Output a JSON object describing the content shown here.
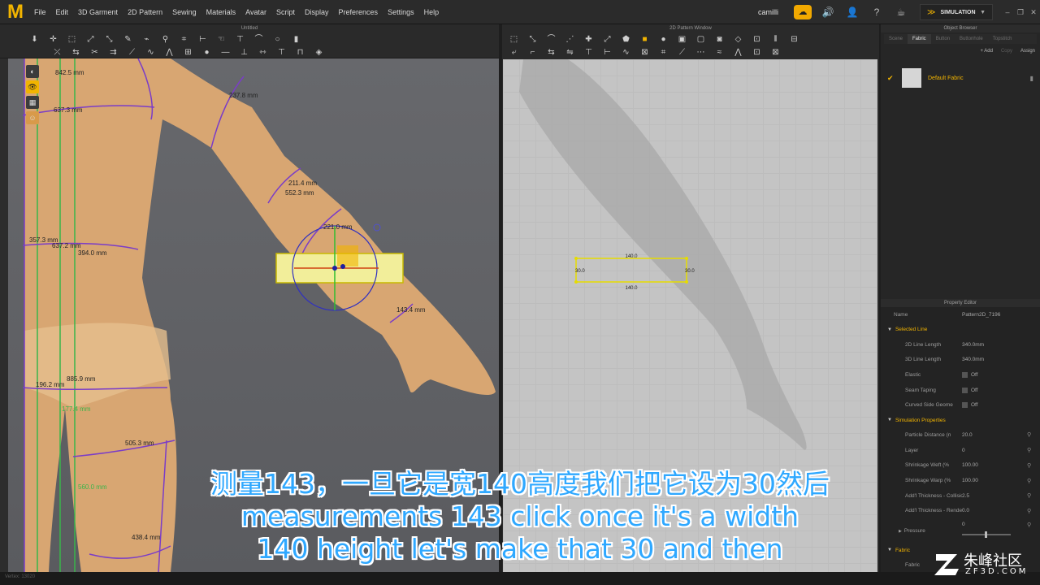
{
  "app": {
    "logo_letter": "M",
    "menus": [
      "File",
      "Edit",
      "3D Garment",
      "2D Pattern",
      "Sewing",
      "Materials",
      "Avatar",
      "Script",
      "Display",
      "Preferences",
      "Settings",
      "Help"
    ],
    "user": "camilli",
    "mode": "SIMULATION",
    "window_controls": [
      "–",
      "❐",
      "✕"
    ]
  },
  "win3d": {
    "title": "Untitled",
    "measurements": [
      "842.5 mm",
      "637.3 mm",
      "237.8 mm",
      "211.4 mm",
      "552.3 mm",
      "221.0 mm",
      "357.3 mm",
      "637.2 mm",
      "394.0 mm",
      "143.4 mm",
      "196.2 mm",
      "885.9 mm",
      "177.4 mm",
      "505.3 mm",
      "560.0 mm",
      "438.4 mm"
    ]
  },
  "win2d": {
    "title": "2D Pattern Window",
    "pattern": {
      "top": "140.0",
      "bottom": "140.0",
      "left": "30.0",
      "right": "30.0"
    }
  },
  "object_browser": {
    "title": "Object Browser",
    "tabs": [
      "Scene",
      "Fabric",
      "Button",
      "Buttonhole",
      "Topstitch"
    ],
    "active_tab": "Fabric",
    "actions": [
      "+ Add",
      "Copy",
      "Assign"
    ],
    "fabric_name": "Default Fabric"
  },
  "property_editor": {
    "title": "Property Editor",
    "name_label": "Name",
    "name_value": "Pattern2D_7196",
    "sections": {
      "selected_line": "Selected Line",
      "simulation": "Simulation Properties",
      "fabric": "Fabric"
    },
    "selected_line": [
      {
        "key": "2D Line Length",
        "value": "340.0mm"
      },
      {
        "key": "3D Line Length",
        "value": "340.0mm"
      },
      {
        "key": "Elastic",
        "value": "Off"
      },
      {
        "key": "Seam Taping",
        "value": "Off"
      },
      {
        "key": "Curved Side Geome",
        "value": "Off"
      }
    ],
    "simulation": [
      {
        "key": "Particle Distance (n",
        "value": "20.0"
      },
      {
        "key": "Layer",
        "value": "0"
      },
      {
        "key": "Shrinkage Weft (%",
        "value": "100.00"
      },
      {
        "key": "Shrinkage Warp (%",
        "value": "100.00"
      },
      {
        "key": "Add'l Thickness - Collisic",
        "value": "2.5"
      },
      {
        "key": "Add'l Thickness - Render",
        "value": "0.0"
      },
      {
        "key": "Pressure",
        "value": "0"
      }
    ],
    "fabric_row": "Fabric"
  },
  "status": "Vertex: 13020",
  "subtitles": {
    "zh": "测量143，一旦它是宽140高度我们把它设为30然后",
    "en1": "measurements 143 click once it's a width",
    "en2": "140 height let's make that 30 and then"
  },
  "watermark": {
    "name": "朱峰社区",
    "url": "ZF3D.COM"
  }
}
